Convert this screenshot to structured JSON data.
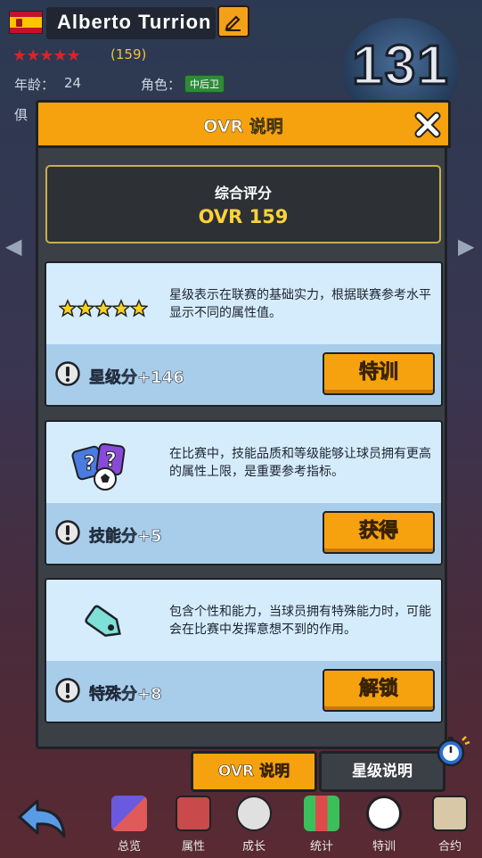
{
  "player": {
    "name": "Alberto Turrion",
    "stars": "★★★★★",
    "star_count": "(159)",
    "age_label": "年龄：",
    "age": "24",
    "role_label": "角色：",
    "role": "中后卫",
    "club_label": "俱",
    "ovr": "131"
  },
  "modal": {
    "title": "OVR 说明",
    "summary_label": "综合评分",
    "summary_value": "OVR 159",
    "cards": [
      {
        "icon": "five-stars-icon",
        "desc": "星级表示在联赛的基础实力，根据联赛参考水平显示不同的属性值。",
        "score": "星级分+146",
        "button": "特训"
      },
      {
        "icon": "skill-ball-icon",
        "desc": "在比赛中，技能品质和等级能够让球员拥有更高的属性上限，是重要参考指标。",
        "score": "技能分+5",
        "button": "获得"
      },
      {
        "icon": "tag-icon",
        "desc": "包含个性和能力，当球员拥有特殊能力时，可能会在比赛中发挥意想不到的作用。",
        "score": "特殊分+8",
        "button": "解锁"
      }
    ]
  },
  "tabs": {
    "ovr": "OVR 说明",
    "star": "星级说明"
  },
  "nav": {
    "items": [
      "总览",
      "属性",
      "成长",
      "统计",
      "特训",
      "合约"
    ]
  },
  "colors": {
    "accent": "#f5a20e",
    "card_top": "#d5ecfc",
    "card_bottom": "#a8cdeb",
    "ovr_gold": "#ffd23a"
  }
}
